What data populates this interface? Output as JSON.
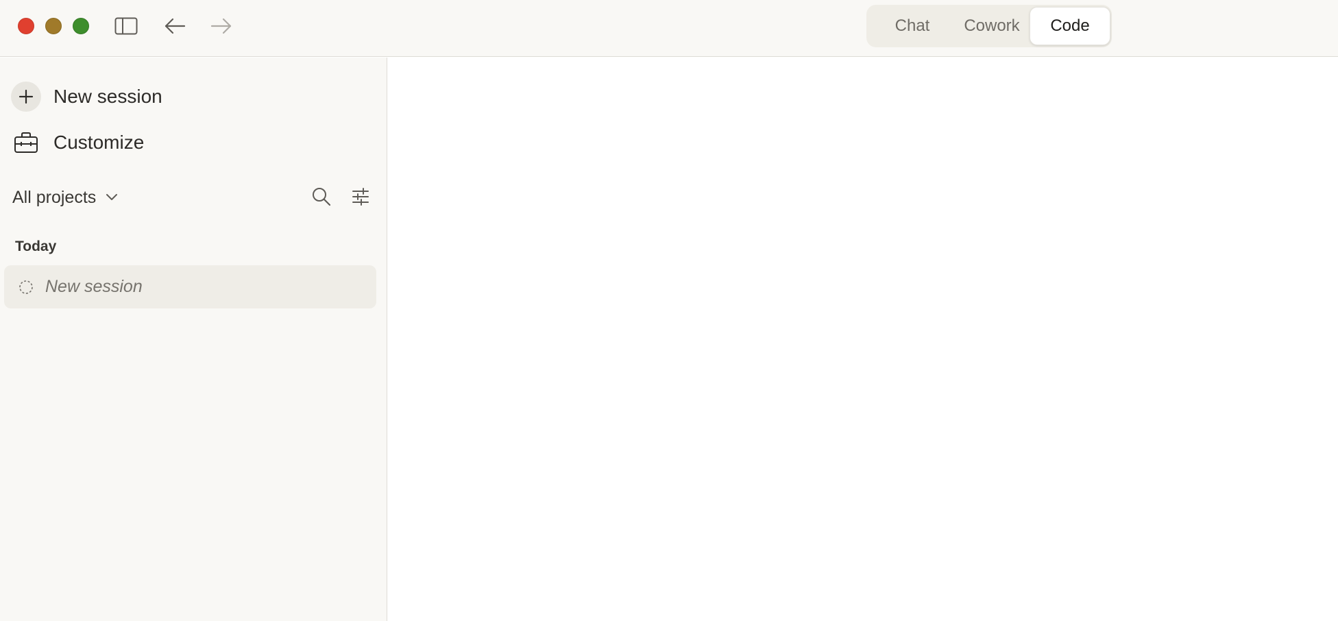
{
  "window": {
    "controls": [
      "close",
      "minimize",
      "zoom"
    ],
    "icons": [
      "sidebar-toggle-icon",
      "back-arrow-icon",
      "forward-arrow-icon"
    ]
  },
  "mode_switch": {
    "tabs": [
      {
        "label": "Chat",
        "active": false
      },
      {
        "label": "Cowork",
        "active": false
      },
      {
        "label": "Code",
        "active": true
      }
    ]
  },
  "sidebar": {
    "new_session_label": "New session",
    "customize_label": "Customize",
    "filter": {
      "label": "All projects",
      "icons": [
        "chevron-down-icon",
        "search-icon",
        "sliders-icon"
      ]
    },
    "sections": [
      {
        "title": "Today",
        "items": [
          {
            "label": "New session",
            "icon": "dashed-circle-icon"
          }
        ]
      }
    ]
  },
  "colors": {
    "close": "#e0402f",
    "minimize": "#a07a2a",
    "zoom": "#3e8e2c",
    "sidebar_bg": "#f9f8f5",
    "selected_item_bg": "#efede7"
  }
}
